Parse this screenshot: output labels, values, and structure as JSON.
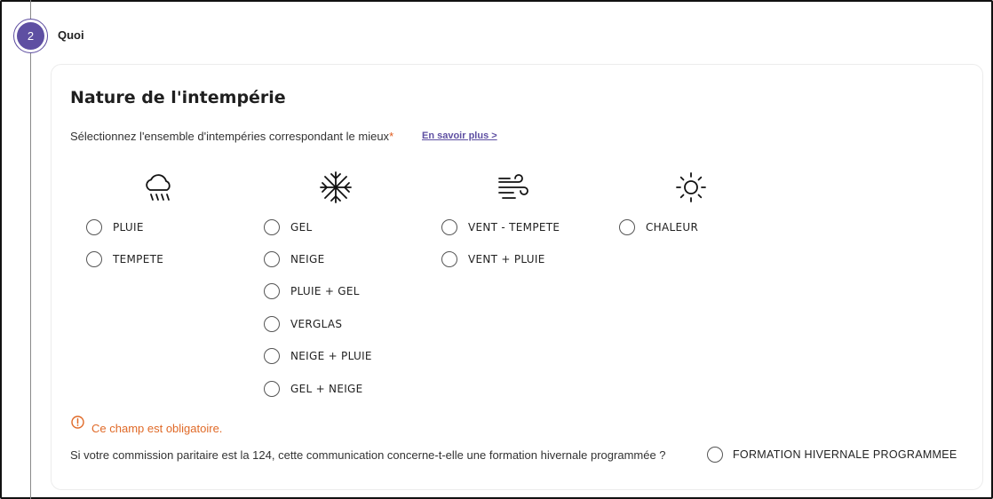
{
  "step": {
    "number": "2",
    "title": "Quoi"
  },
  "section": {
    "title": "Nature de l'intempérie",
    "instruction": "Sélectionnez l'ensemble d'intempéries correspondant le mieux",
    "required_mark": "*",
    "learn_more": "En savoir plus >"
  },
  "columns": [
    {
      "icon": "rain-cloud-icon",
      "options": [
        "PLUIE",
        "TEMPETE"
      ]
    },
    {
      "icon": "snowflake-icon",
      "options": [
        "GEL",
        "NEIGE",
        "PLUIE + GEL",
        "VERGLAS",
        "NEIGE + PLUIE",
        "GEL + NEIGE"
      ]
    },
    {
      "icon": "wind-icon",
      "options": [
        "VENT - TEMPETE",
        "VENT + PLUIE"
      ]
    },
    {
      "icon": "sun-icon",
      "options": [
        "CHALEUR"
      ]
    }
  ],
  "error": {
    "message": "Ce champ est obligatoire."
  },
  "formation": {
    "question": "Si votre commission paritaire est la 124, cette communication concerne-t-elle une formation hivernale programmée ?",
    "option_label": "FORMATION HIVERNALE PROGRAMMEE"
  },
  "colors": {
    "accent": "#5e4fa2",
    "error": "#e06a28"
  }
}
